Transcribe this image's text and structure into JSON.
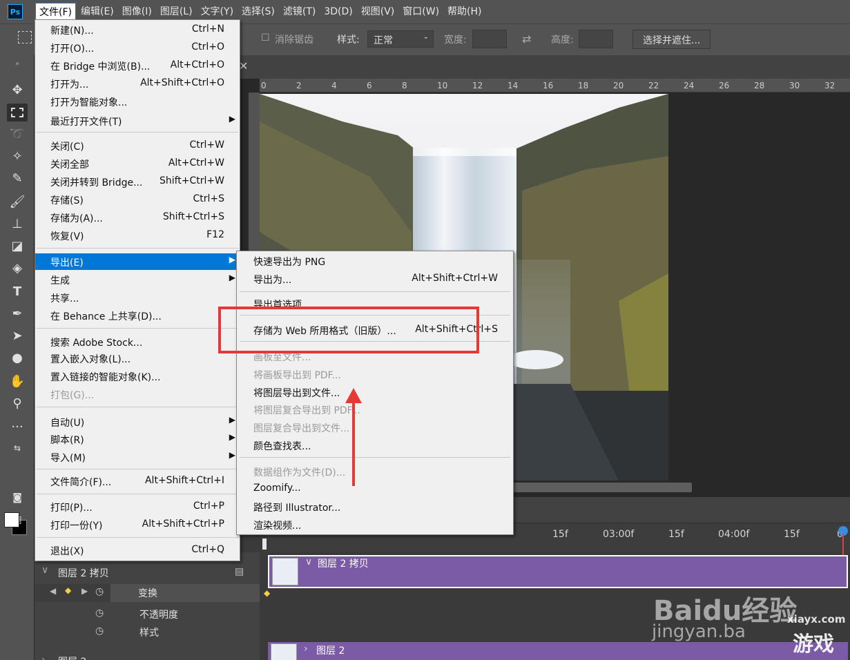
{
  "app": {
    "logo": "Ps"
  },
  "menubar": {
    "items": [
      "文件(F)",
      "编辑(E)",
      "图像(I)",
      "图层(L)",
      "文字(Y)",
      "选择(S)",
      "滤镜(T)",
      "3D(D)",
      "视图(V)",
      "窗口(W)",
      "帮助(H)"
    ]
  },
  "options": {
    "antialias": "消除锯齿",
    "style_label": "样式:",
    "style_value": "正常",
    "width_label": "宽度:",
    "height_label": "高度:",
    "select_mask": "选择并遮住..."
  },
  "ruler": [
    "0",
    "2",
    "4",
    "6",
    "8",
    "10",
    "12",
    "14",
    "16",
    "18",
    "20",
    "22",
    "24",
    "26",
    "28",
    "30",
    "32"
  ],
  "file_menu": {
    "items": [
      {
        "label": "新建(N)...",
        "shortcut": "Ctrl+N"
      },
      {
        "label": "打开(O)...",
        "shortcut": "Ctrl+O"
      },
      {
        "label": "在 Bridge 中浏览(B)...",
        "shortcut": "Alt+Ctrl+O"
      },
      {
        "label": "打开为...",
        "shortcut": "Alt+Shift+Ctrl+O"
      },
      {
        "label": "打开为智能对象...",
        "shortcut": ""
      },
      {
        "label": "最近打开文件(T)",
        "shortcut": ""
      },
      {
        "label": "关闭(C)",
        "shortcut": "Ctrl+W"
      },
      {
        "label": "关闭全部",
        "shortcut": "Alt+Ctrl+W"
      },
      {
        "label": "关闭并转到 Bridge...",
        "shortcut": "Shift+Ctrl+W"
      },
      {
        "label": "存储(S)",
        "shortcut": "Ctrl+S"
      },
      {
        "label": "存储为(A)...",
        "shortcut": "Shift+Ctrl+S"
      },
      {
        "label": "恢复(V)",
        "shortcut": "F12"
      },
      {
        "label": "导出(E)",
        "shortcut": ""
      },
      {
        "label": "生成",
        "shortcut": ""
      },
      {
        "label": "共享...",
        "shortcut": ""
      },
      {
        "label": "在 Behance 上共享(D)...",
        "shortcut": ""
      },
      {
        "label": "搜索 Adobe Stock...",
        "shortcut": ""
      },
      {
        "label": "置入嵌入对象(L)...",
        "shortcut": ""
      },
      {
        "label": "置入链接的智能对象(K)...",
        "shortcut": ""
      },
      {
        "label": "打包(G)...",
        "shortcut": ""
      },
      {
        "label": "自动(U)",
        "shortcut": ""
      },
      {
        "label": "脚本(R)",
        "shortcut": ""
      },
      {
        "label": "导入(M)",
        "shortcut": ""
      },
      {
        "label": "文件简介(F)...",
        "shortcut": "Alt+Shift+Ctrl+I"
      },
      {
        "label": "打印(P)...",
        "shortcut": "Ctrl+P"
      },
      {
        "label": "打印一份(Y)",
        "shortcut": "Alt+Shift+Ctrl+P"
      },
      {
        "label": "退出(X)",
        "shortcut": "Ctrl+Q"
      }
    ]
  },
  "export_menu": {
    "items": [
      {
        "label": "快速导出为 PNG",
        "shortcut": ""
      },
      {
        "label": "导出为...",
        "shortcut": "Alt+Shift+Ctrl+W"
      },
      {
        "label": "导出首选项...",
        "shortcut": ""
      },
      {
        "label": "存储为 Web 所用格式（旧版）...",
        "shortcut": "Alt+Shift+Ctrl+S"
      },
      {
        "label": "画板至文件...",
        "shortcut": ""
      },
      {
        "label": "将画板导出到 PDF...",
        "shortcut": ""
      },
      {
        "label": "将图层导出到文件...",
        "shortcut": ""
      },
      {
        "label": "将图层复合导出到 PDF...",
        "shortcut": ""
      },
      {
        "label": "图层复合导出到文件...",
        "shortcut": ""
      },
      {
        "label": "颜色查找表...",
        "shortcut": ""
      },
      {
        "label": "数据组作为文件(D)...",
        "shortcut": ""
      },
      {
        "label": "Zoomify...",
        "shortcut": ""
      },
      {
        "label": "路径到 Illustrator...",
        "shortcut": ""
      },
      {
        "label": "渲染视频...",
        "shortcut": ""
      }
    ]
  },
  "timeline": {
    "times": [
      "15f",
      "03:00f",
      "15f",
      "04:00f",
      "15f",
      "0"
    ],
    "layer_copy": "图层 2 拷贝",
    "transform": "变换",
    "opacity": "不透明度",
    "style": "样式",
    "layer2": "图层 2",
    "layer2_partial": "图层 2"
  },
  "watermarks": {
    "baidu": "Baidu经验",
    "jingyan": "jingyan.ba",
    "site": "xiayx.com",
    "game": "游戏"
  }
}
